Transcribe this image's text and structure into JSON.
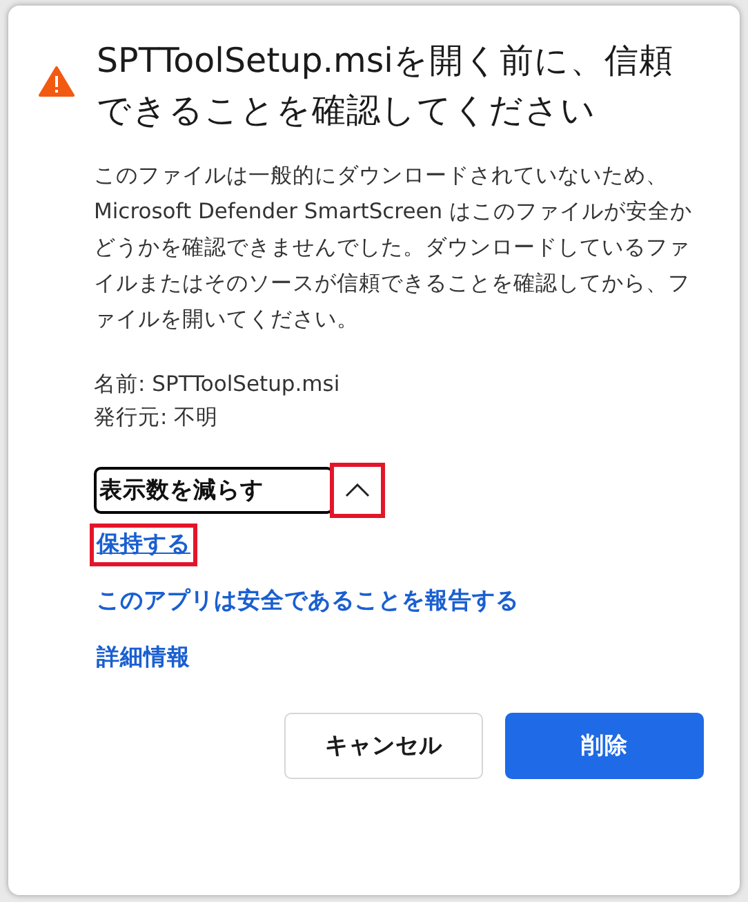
{
  "dialog": {
    "title": "SPTToolSetup.msiを開く前に、信頼できることを確認してください",
    "message": "このファイルは一般的にダウンロードされていないため、Microsoft Defender SmartScreen はこのファイルが安全かどうかを確認できませんでした。ダウンロードしているファイルまたはそのソースが信頼できることを確認してから、ファイルを開いてください。",
    "details": [
      {
        "label": "名前:",
        "value": "SPTToolSetup.msi"
      },
      {
        "label": "発行元:",
        "value": "不明"
      }
    ],
    "toggle": {
      "label": "表示数を減らす",
      "expanded": true,
      "highlighted": true
    },
    "links": [
      {
        "label": "保持する",
        "underlined": true,
        "highlighted": true
      },
      {
        "label": "このアプリは安全であることを報告する",
        "underlined": false,
        "highlighted": false
      },
      {
        "label": "詳細情報",
        "underlined": false,
        "highlighted": false
      }
    ],
    "buttons": [
      {
        "label": "キャンセル",
        "kind": "secondary"
      },
      {
        "label": "削除",
        "kind": "primary"
      }
    ]
  }
}
